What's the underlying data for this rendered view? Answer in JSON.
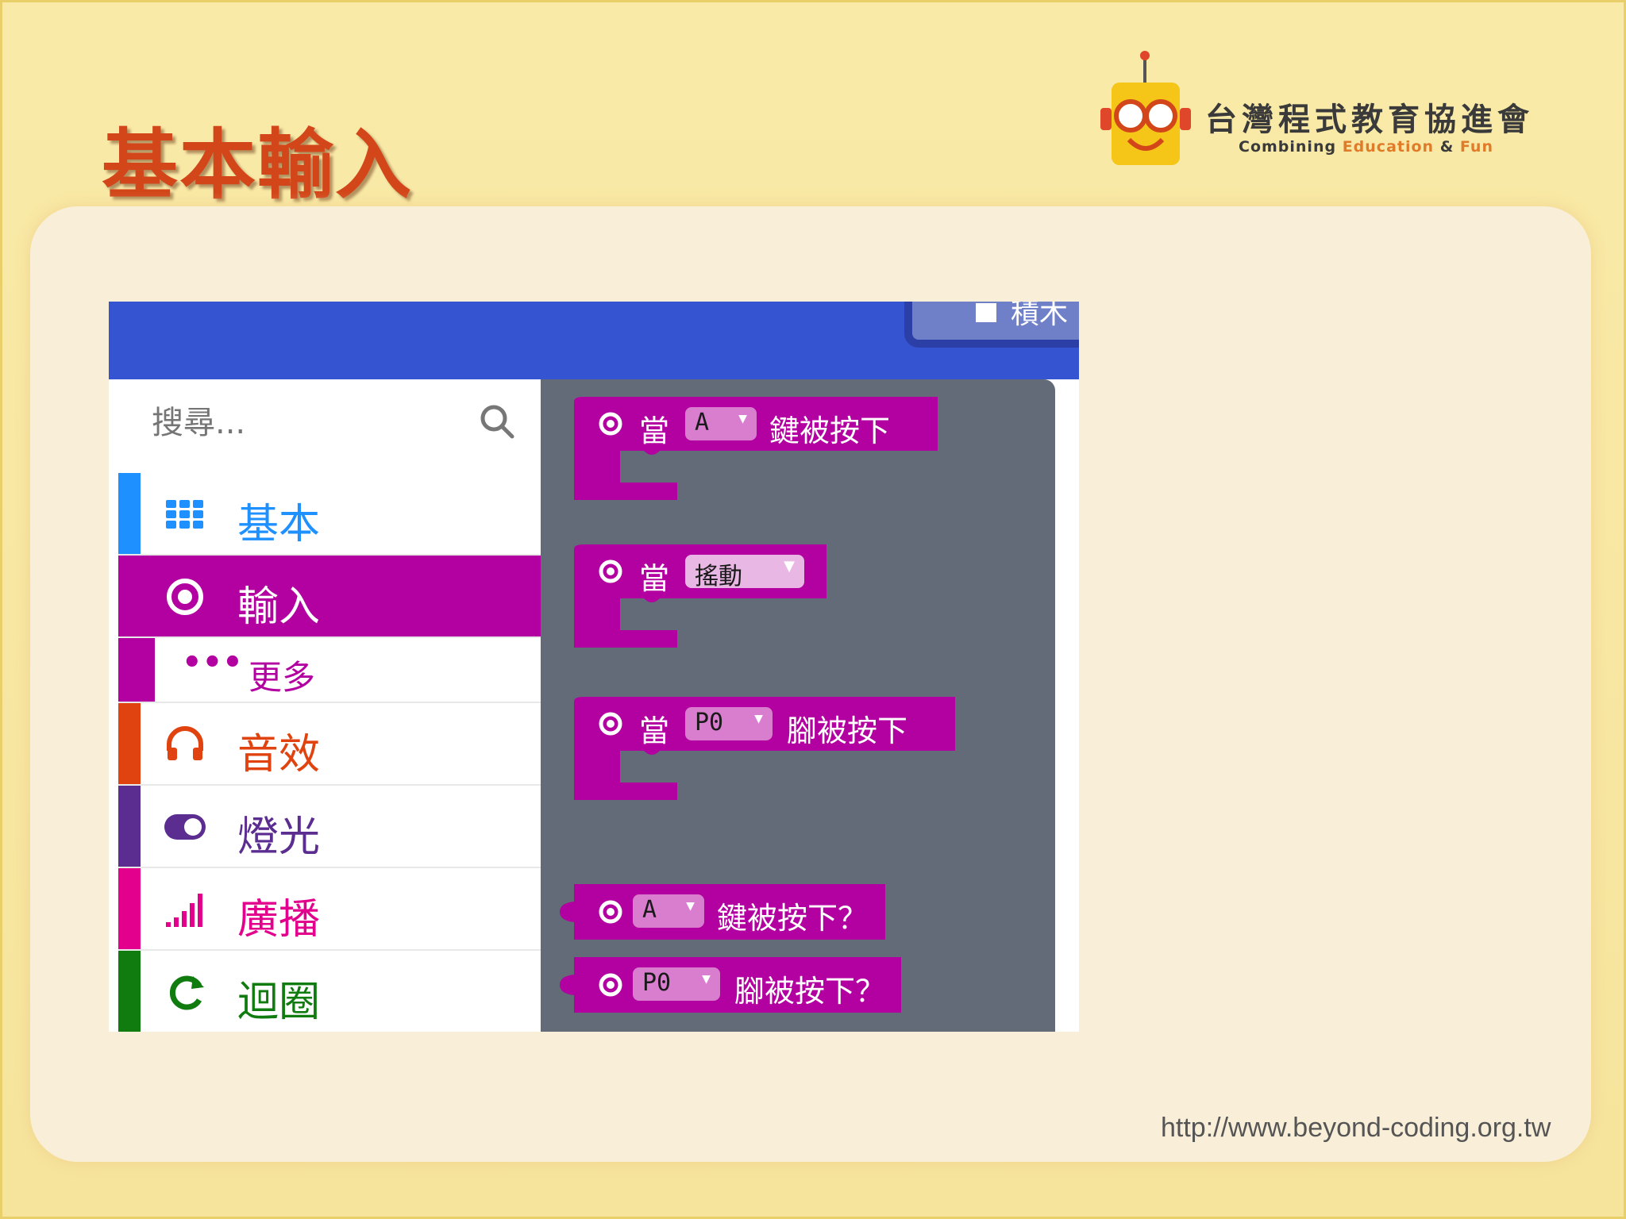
{
  "slide": {
    "title": "基本輸入",
    "footer_url": "http://www.beyond-coding.org.tw"
  },
  "logo": {
    "name": "台灣程式教育協進會",
    "tagline_prefix": "Combining ",
    "tagline_edu": "Education",
    "tagline_mid": " & ",
    "tagline_fun": "Fun"
  },
  "topbar": {
    "button_label": "積木"
  },
  "search": {
    "placeholder": "搜尋..."
  },
  "categories": [
    {
      "label": "基本",
      "color": "#1e90ff"
    },
    {
      "label": "輸入",
      "color": "#b300a0"
    },
    {
      "label": "更多",
      "color": "#b300a0"
    },
    {
      "label": "音效",
      "color": "#e0430f"
    },
    {
      "label": "燈光",
      "color": "#5c2d91"
    },
    {
      "label": "廣播",
      "color": "#e3008c"
    },
    {
      "label": "迴圈",
      "color": "#107c10"
    }
  ],
  "blocks": {
    "b1": {
      "when": "當",
      "dd": "A",
      "tail": "鍵被按下"
    },
    "b2": {
      "when": "當",
      "dd": "搖動"
    },
    "b3": {
      "when": "當",
      "dd": "P0",
      "tail": "腳被按下"
    },
    "b4": {
      "dd": "A",
      "tail": "鍵被按下？"
    },
    "b5": {
      "dd": "P0",
      "tail": "腳被按下？"
    }
  },
  "colors": {
    "topbar": "#3454d1",
    "input_magenta": "#b300a0",
    "workspace": "#646b78",
    "title": "#d2461a"
  }
}
